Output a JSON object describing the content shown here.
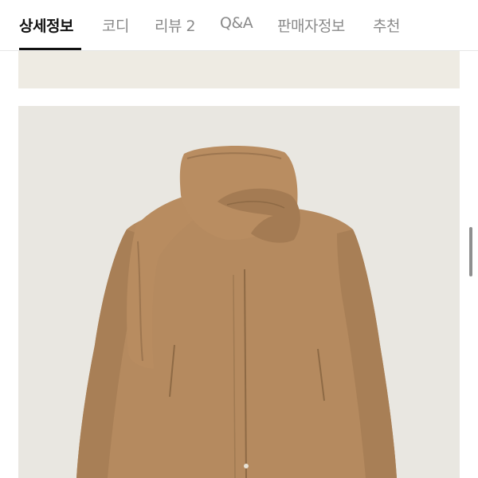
{
  "tabs": [
    {
      "label": "상세정보",
      "active": true
    },
    {
      "label": "코디",
      "active": false
    },
    {
      "label": "리뷰 2",
      "active": false
    },
    {
      "label": "Q&A",
      "active": false
    },
    {
      "label": "판매자정보",
      "active": false
    },
    {
      "label": "추천",
      "active": false
    }
  ],
  "colors": {
    "coat": "#b58a5f",
    "coat_shadow": "#9d7650",
    "coat_light": "#c39a6e",
    "image_bg": "#e9e7e1",
    "strip_bg": "#eeebe3"
  }
}
